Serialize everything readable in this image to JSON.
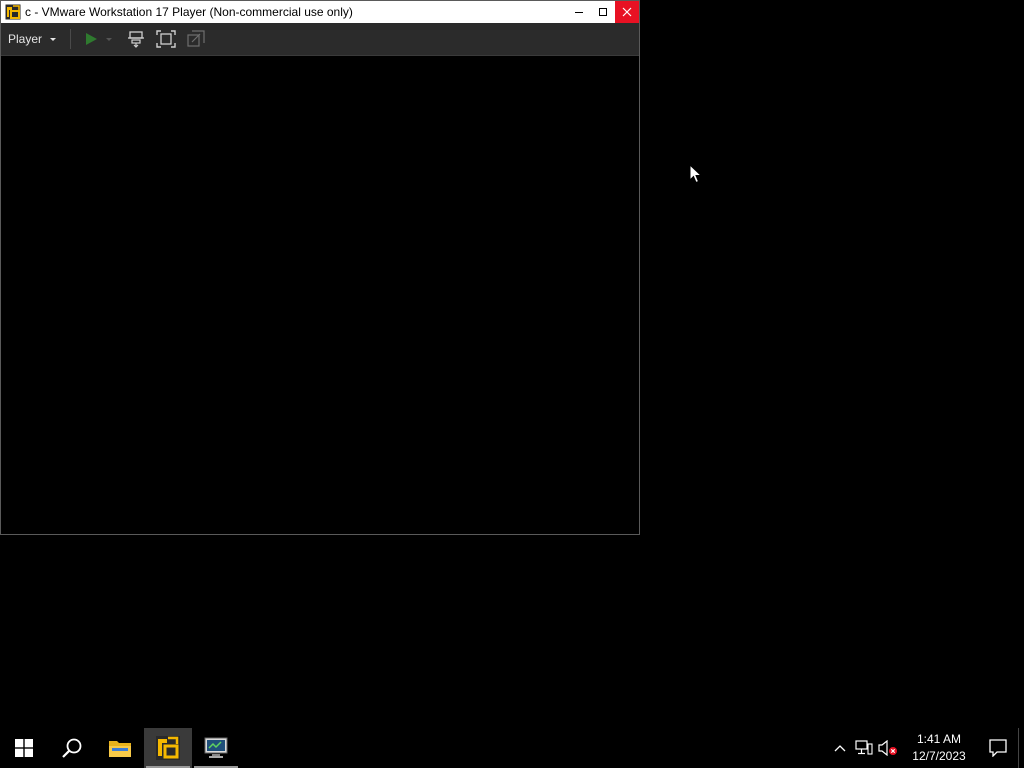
{
  "window": {
    "title": "c - VMware Workstation 17 Player (Non-commercial use only)",
    "controls": [
      "minimize-icon",
      "maximize-icon",
      "close-icon"
    ]
  },
  "toolbar": {
    "player_menu_label": "Player",
    "buttons": [
      "play-icon",
      "send-ctrl-alt-del-icon",
      "fullscreen-icon",
      "unity-icon"
    ]
  },
  "taskbar": {
    "pinned": [
      "windows-start-icon",
      "search-icon",
      "file-explorer-icon",
      "vmware-player-icon",
      "server-manager-icon"
    ],
    "clock": {
      "time": "1:41 AM",
      "date": "12/7/2023"
    },
    "tray_icons": [
      "show-hidden-icons-chevron",
      "network-icon",
      "volume-muted-icon",
      "action-center-icon"
    ]
  },
  "colors": {
    "close_button": "#e81123",
    "toolbar_bg": "#2b2b2b",
    "desktop_bg": "#000000",
    "vmware_yellow": "#f5b800"
  }
}
